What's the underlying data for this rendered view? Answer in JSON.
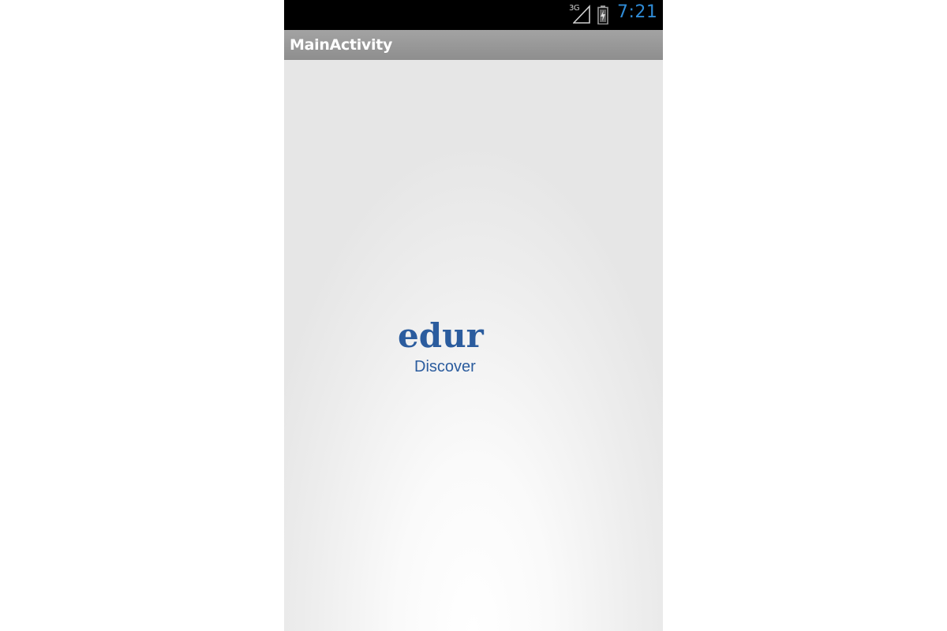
{
  "status_bar": {
    "network_type": "3G",
    "signal_icon": "signal-icon",
    "battery_icon": "battery-icon",
    "time": "7:21",
    "clock_color": "#2f8bd6"
  },
  "action_bar": {
    "title": "MainActivity"
  },
  "splash": {
    "logo_text": "edur",
    "tagline": "Discover",
    "brand_color": "#2b5c9e"
  }
}
